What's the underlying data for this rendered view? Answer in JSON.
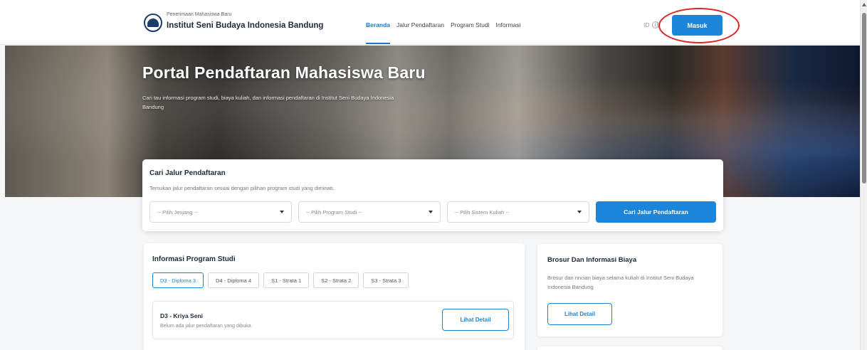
{
  "header": {
    "brand_subtitle": "Penerimaan Mahasiswa Baru",
    "brand_title": "Institut Seni Budaya Indonesia Bandung",
    "nav": [
      "Beranda",
      "Jalur Pendaftaran",
      "Program Studi",
      "Informasi"
    ],
    "active_nav": "Beranda",
    "language": "ID",
    "login_label": "Masuk"
  },
  "hero": {
    "title": "Portal Pendaftaran Mahasiswa Baru",
    "description": "Cari tau informasi program studi, biaya kuliah, dan informasi pendaftaran di Institut Seni Budaya Indonesia Bandung"
  },
  "search": {
    "title": "Cari Jalur Pendaftaran",
    "subtitle": "Temukan jalur pendaftaran sesuai dengan pilihan program studi yang diminati.",
    "select_level": "-- Pilih Jenjang --",
    "select_program": "-- Pilih Program Studi --",
    "select_system": "-- Pilih Sistem Kuliah --",
    "button_label": "Cari Jalur Pendaftaran"
  },
  "programs": {
    "title": "Informasi Program Studi",
    "tabs": [
      "D3 - Diploma 3",
      "D4 - Diploma 4",
      "S1 - Strata 1",
      "S2 - Strata 2",
      "S3 - Strata 3"
    ],
    "active_tab": "D3 - Diploma 3",
    "items": [
      {
        "name": "D3 - Kriya Seni",
        "status": "Belum ada jalur pendaftaran yang dibuka",
        "button": "Lihat Detail"
      }
    ]
  },
  "brochure": {
    "title": "Brosur Dan Informasi Biaya",
    "description": "Brosur dan rincian biaya selama kuliah di Institut Seni Budaya Indonesia Bandung",
    "button": "Lihat Detail"
  },
  "colors": {
    "accent": "#1b86d9",
    "highlight": "#e02424"
  }
}
